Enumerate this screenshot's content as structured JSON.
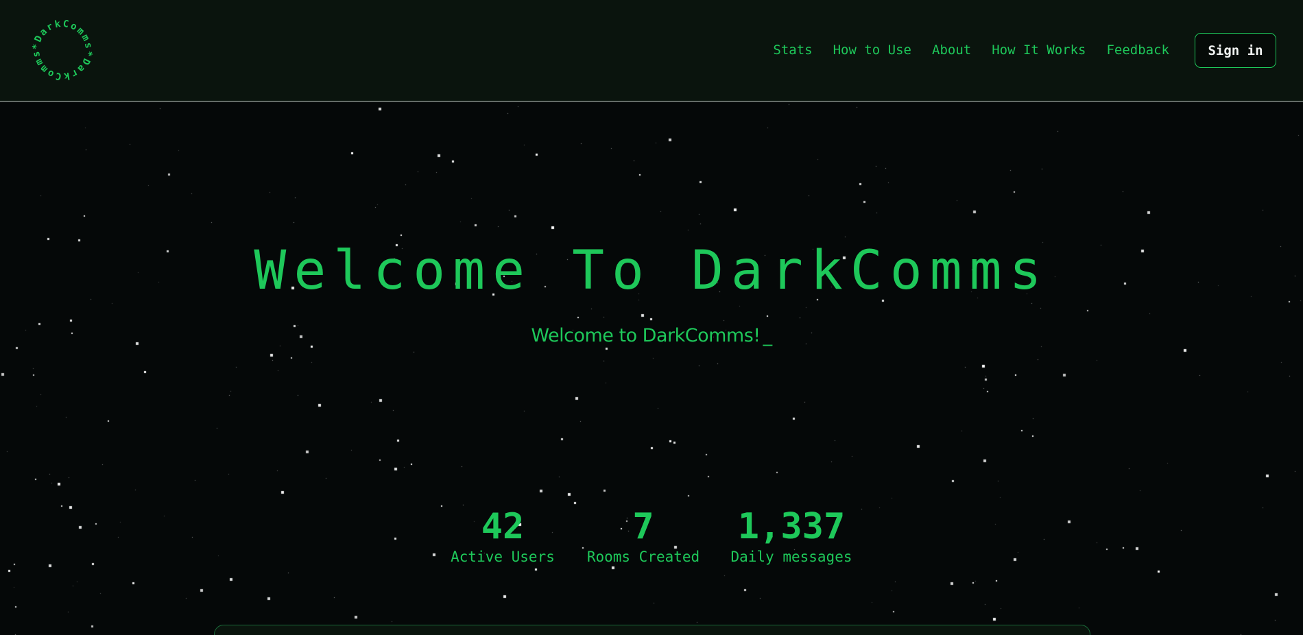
{
  "brand": {
    "logo_text": "*DarkComms*DarkComms",
    "accent_color": "#1ec85a",
    "background_color": "#050808"
  },
  "nav": {
    "items": [
      {
        "label": "Stats"
      },
      {
        "label": "How to Use"
      },
      {
        "label": "About"
      },
      {
        "label": "How It Works"
      },
      {
        "label": "Feedback"
      }
    ],
    "sign_in_label": "Sign in"
  },
  "hero": {
    "title": "Welcome To DarkComms",
    "subtitle": "Welcome to DarkComms!",
    "cursor": "_"
  },
  "stats": [
    {
      "value": "42",
      "label": "Active Users"
    },
    {
      "value": "7",
      "label": "Rooms Created"
    },
    {
      "value": "1,337",
      "label": "Daily messages"
    }
  ]
}
